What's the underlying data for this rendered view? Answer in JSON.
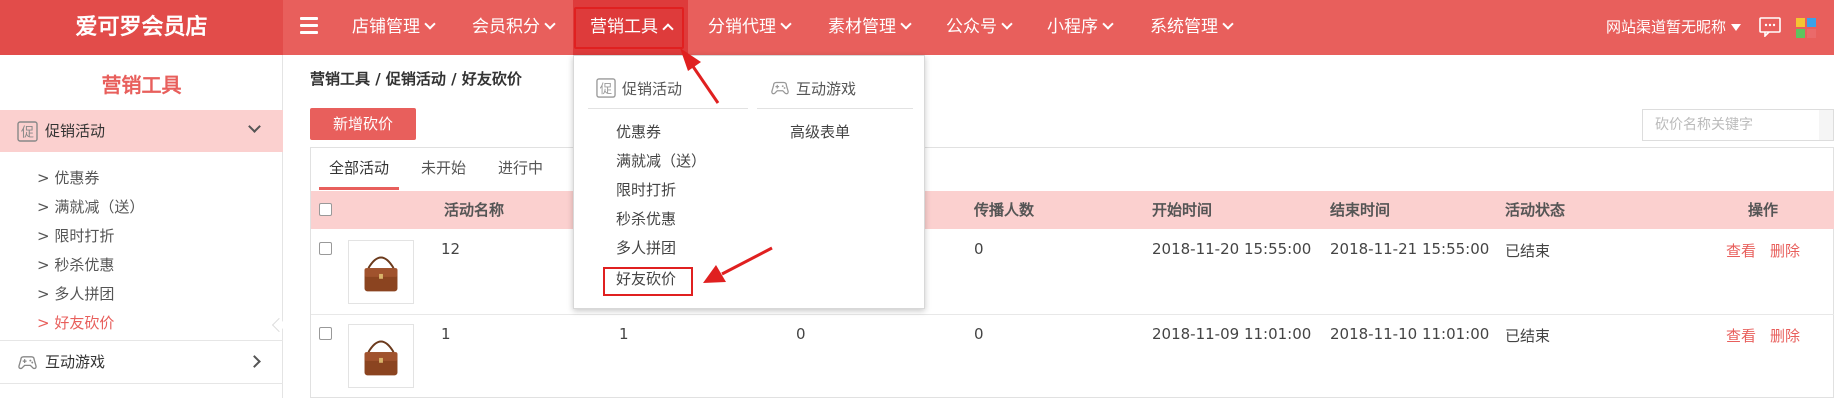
{
  "app": {
    "store_name": "爱可罗会员店"
  },
  "nav": {
    "items": [
      {
        "label": "店铺管理"
      },
      {
        "label": "会员积分"
      },
      {
        "label": "营销工具"
      },
      {
        "label": "分销代理"
      },
      {
        "label": "素材管理"
      },
      {
        "label": "公众号"
      },
      {
        "label": "小程序"
      },
      {
        "label": "系统管理"
      }
    ],
    "user_label": "网站渠道暂无昵称"
  },
  "sidebar": {
    "title": "营销工具",
    "groups": [
      {
        "label": "促销活动",
        "icon": "promo-icon",
        "items": [
          {
            "label": "> 优惠券"
          },
          {
            "label": "> 满就减（送）"
          },
          {
            "label": "> 限时打折"
          },
          {
            "label": "> 秒杀优惠"
          },
          {
            "label": "> 多人拼团"
          },
          {
            "label": "> 好友砍价"
          }
        ]
      },
      {
        "label": "互动游戏",
        "icon": "gamepad-icon"
      }
    ]
  },
  "main": {
    "breadcrumb": "营销工具 / 促销活动 / 好友砍价",
    "add_button": "新增砍价",
    "search_placeholder": "砍价名称关键字",
    "tabs": [
      {
        "label": "全部活动"
      },
      {
        "label": "未开始"
      },
      {
        "label": "进行中"
      }
    ],
    "columns": {
      "name": "活动名称",
      "spread": "传播人数",
      "start": "开始时间",
      "end": "结束时间",
      "status": "活动状态",
      "actions": "操作"
    },
    "rows": [
      {
        "name": "12",
        "col_c": "",
        "col_d": "",
        "spread": "0",
        "start": "2018-11-20 15:55:00",
        "end": "2018-11-21 15:55:00",
        "status": "已结束",
        "view": "查看",
        "delete": "删除"
      },
      {
        "name": "1",
        "col_c": "1",
        "col_d": "0",
        "spread": "0",
        "start": "2018-11-09 11:01:00",
        "end": "2018-11-10 11:01:00",
        "status": "已结束",
        "view": "查看",
        "delete": "删除"
      }
    ]
  },
  "dropdown": {
    "promo": {
      "title": "促销活动",
      "items": [
        "优惠券",
        "满就减（送）",
        "限时打折",
        "秒杀优惠",
        "多人拼团",
        "好友砍价"
      ]
    },
    "games": {
      "title": "互动游戏",
      "items": [
        "高级表单"
      ]
    }
  },
  "colors": {
    "brand": "#e85f5c",
    "highlight": "#e02020",
    "header_row": "#fbd0cf"
  }
}
